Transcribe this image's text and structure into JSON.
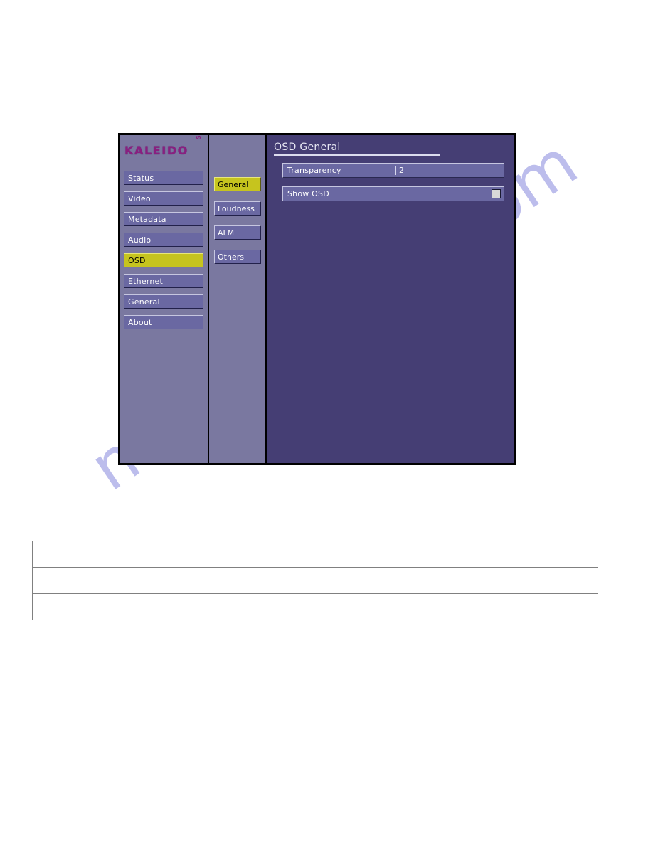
{
  "page": {
    "background_color": "#ffffff",
    "watermark_text": "manualshive.com",
    "watermark_color": "#b9baec"
  },
  "device_ui": {
    "colors": {
      "sidebar_bg": "#7a78a0",
      "main_bg": "#453e74",
      "button_bg": "#6a68a2",
      "button_selected_bg": "#c6c41e",
      "button_border_light": "#c6c6e0",
      "button_text": "#ffffff",
      "logo_color": "#8a1f80",
      "outer_border": "#000000"
    },
    "logo": {
      "name": "KALEIDO",
      "sub": "Solo"
    },
    "nav": {
      "items": [
        {
          "label": "Status",
          "selected": false
        },
        {
          "label": "Video",
          "selected": false
        },
        {
          "label": "Metadata",
          "selected": false
        },
        {
          "label": "Audio",
          "selected": false
        },
        {
          "label": "OSD",
          "selected": true
        },
        {
          "label": "Ethernet",
          "selected": false
        },
        {
          "label": "General",
          "selected": false
        },
        {
          "label": "About",
          "selected": false
        }
      ]
    },
    "subnav": {
      "items": [
        {
          "label": "General",
          "selected": true
        },
        {
          "label": "Loudness",
          "selected": false
        },
        {
          "label": "ALM",
          "selected": false
        },
        {
          "label": "Others",
          "selected": false
        }
      ]
    },
    "panel": {
      "title": "OSD General",
      "fields": [
        {
          "label": "Transparency",
          "value": "2",
          "type": "value",
          "icon": "none"
        },
        {
          "label": "Show OSD",
          "value": "",
          "type": "checkbox",
          "checked": false,
          "icon": "checkbox-icon"
        }
      ]
    }
  },
  "bottom_table": {
    "rows": [
      {
        "cells": [
          "",
          ""
        ]
      },
      {
        "cells": [
          "",
          ""
        ]
      },
      {
        "cells": [
          "",
          ""
        ]
      }
    ]
  }
}
